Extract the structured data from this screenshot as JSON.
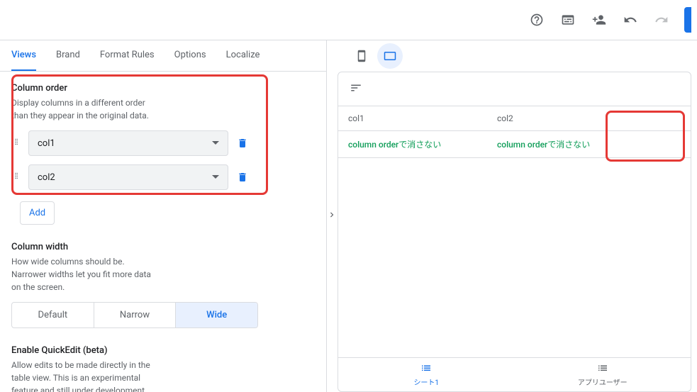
{
  "toolbar": {
    "icons": [
      "help",
      "console",
      "share",
      "undo",
      "redo"
    ]
  },
  "tabs": [
    {
      "label": "Views",
      "active": true
    },
    {
      "label": "Brand",
      "active": false
    },
    {
      "label": "Format Rules",
      "active": false
    },
    {
      "label": "Options",
      "active": false
    },
    {
      "label": "Localize",
      "active": false
    }
  ],
  "columnOrder": {
    "title": "Column order",
    "description": "Display columns in a different order than they appear in the original data.",
    "items": [
      {
        "label": "col1"
      },
      {
        "label": "col2"
      }
    ],
    "addLabel": "Add"
  },
  "columnWidth": {
    "title": "Column width",
    "description": "How wide columns should be. Narrower widths let you fit more data on the screen.",
    "options": [
      {
        "label": "Default",
        "active": false
      },
      {
        "label": "Narrow",
        "active": false
      },
      {
        "label": "Wide",
        "active": true
      }
    ]
  },
  "quickEdit": {
    "title": "Enable QuickEdit (beta)",
    "description": "Allow edits to be made directly in the table view. This is an experimental feature and still under development."
  },
  "preview": {
    "columns": [
      "col1",
      "col2"
    ],
    "row": [
      "column orderで消さない",
      "column orderで消さない"
    ]
  },
  "bottomNav": [
    {
      "label": "シート1",
      "active": true,
      "icon": "list"
    },
    {
      "label": "アプリユーザー",
      "active": false,
      "icon": "list"
    }
  ]
}
